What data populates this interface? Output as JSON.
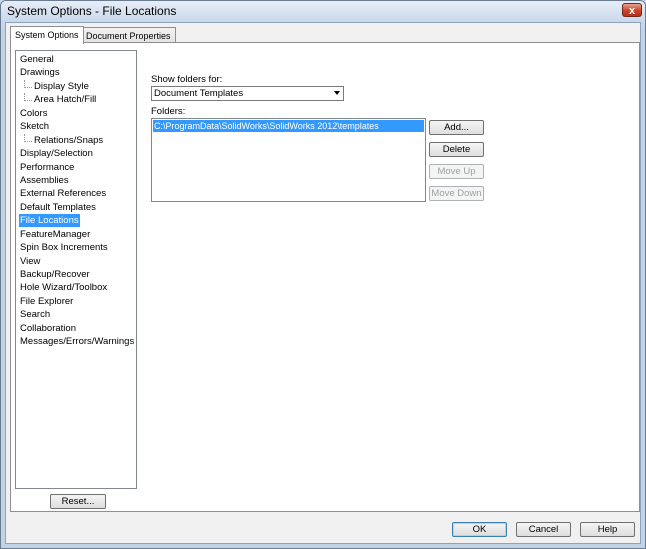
{
  "window": {
    "title": "System Options - File Locations",
    "close_label": "x"
  },
  "tabs": [
    {
      "label": "System Options",
      "active": true
    },
    {
      "label": "Document Properties",
      "active": false
    }
  ],
  "tree": [
    {
      "label": "General",
      "level": 0
    },
    {
      "label": "Drawings",
      "level": 0
    },
    {
      "label": "Display Style",
      "level": 1
    },
    {
      "label": "Area Hatch/Fill",
      "level": 1
    },
    {
      "label": "Colors",
      "level": 0
    },
    {
      "label": "Sketch",
      "level": 0
    },
    {
      "label": "Relations/Snaps",
      "level": 1
    },
    {
      "label": "Display/Selection",
      "level": 0
    },
    {
      "label": "Performance",
      "level": 0
    },
    {
      "label": "Assemblies",
      "level": 0
    },
    {
      "label": "External References",
      "level": 0
    },
    {
      "label": "Default Templates",
      "level": 0
    },
    {
      "label": "File Locations",
      "level": 0,
      "selected": true
    },
    {
      "label": "FeatureManager",
      "level": 0
    },
    {
      "label": "Spin Box Increments",
      "level": 0
    },
    {
      "label": "View",
      "level": 0
    },
    {
      "label": "Backup/Recover",
      "level": 0
    },
    {
      "label": "Hole Wizard/Toolbox",
      "level": 0
    },
    {
      "label": "File Explorer",
      "level": 0
    },
    {
      "label": "Search",
      "level": 0
    },
    {
      "label": "Collaboration",
      "level": 0
    },
    {
      "label": "Messages/Errors/Warnings",
      "level": 0
    }
  ],
  "reset_label": "Reset...",
  "show_folders": {
    "label": "Show folders for:",
    "selected": "Document Templates"
  },
  "folders": {
    "label": "Folders:",
    "items": [
      "C:\\ProgramData\\SolidWorks\\SolidWorks 2012\\templates"
    ]
  },
  "folder_buttons": {
    "add": "Add...",
    "delete": "Delete",
    "move_up": "Move Up",
    "move_down": "Move Down"
  },
  "dialog_buttons": {
    "ok": "OK",
    "cancel": "Cancel",
    "help": "Help"
  },
  "colors": {
    "selection": "#3399ff",
    "close_button": "#c7452a"
  }
}
